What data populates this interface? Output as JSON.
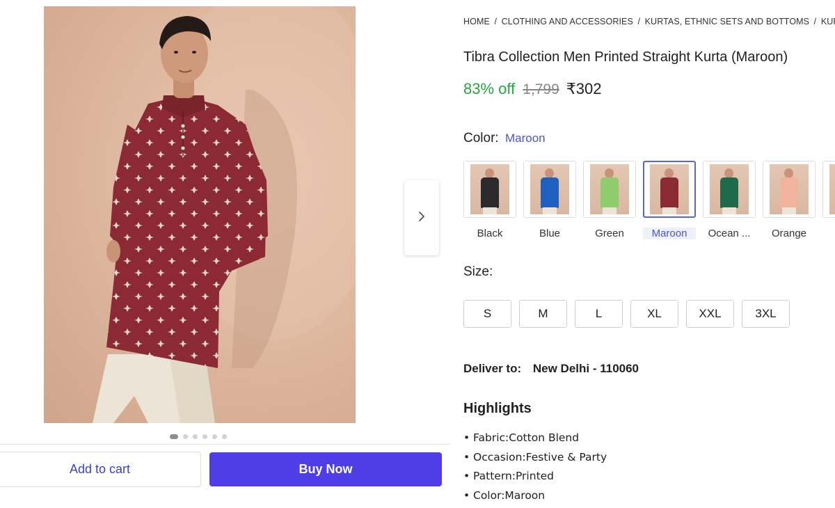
{
  "breadcrumb": [
    "HOME",
    "CLOTHING AND ACCESSORIES",
    "KURTAS, ETHNIC SETS AND BOTTOMS",
    "KURTAS"
  ],
  "breadcrumb_separator": "/",
  "product": {
    "title": "Tibra Collection Men Printed Straight Kurta (Maroon)",
    "discount": "83% off",
    "mrp": "1,799",
    "price": "₹302"
  },
  "color": {
    "label": "Color:",
    "selected": "Maroon",
    "options": [
      {
        "label": "Black",
        "hex": "#2b2b2e",
        "selected": false
      },
      {
        "label": "Blue",
        "hex": "#1f5fbf",
        "selected": false
      },
      {
        "label": "Green",
        "hex": "#8fcc6b",
        "selected": false
      },
      {
        "label": "Maroon",
        "hex": "#8c2a33",
        "selected": true
      },
      {
        "label": "Ocean ...",
        "hex": "#1f6a4a",
        "selected": false
      },
      {
        "label": "Orange",
        "hex": "#f0b49c",
        "selected": false
      },
      {
        "label": "",
        "hex": "#6b6b6b",
        "selected": false
      }
    ]
  },
  "size": {
    "label": "Size:",
    "options": [
      "S",
      "M",
      "L",
      "XL",
      "XXL",
      "3XL"
    ]
  },
  "delivery": {
    "label": "Deliver to:",
    "location": "New Delhi - 110060"
  },
  "highlights": {
    "heading": "Highlights",
    "items": [
      "Fabric:Cotton Blend",
      "Occasion:Festive & Party",
      "Pattern:Printed",
      "Color:Maroon"
    ]
  },
  "actions": {
    "add_to_cart": "Add to cart",
    "buy_now": "Buy Now"
  },
  "carousel": {
    "total_images": 6,
    "active_index": 0
  },
  "colors": {
    "accent": "#4f3de8",
    "link": "#4b56c8",
    "discount": "#26a541",
    "kurta": "#8c2a33"
  },
  "icons": {
    "next": "chevron-right-icon"
  }
}
